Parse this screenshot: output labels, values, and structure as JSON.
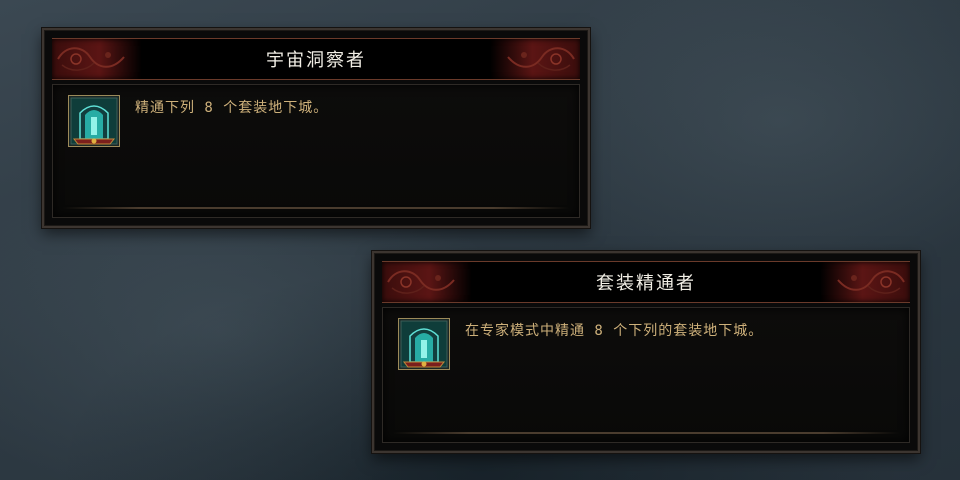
{
  "achievements": [
    {
      "title": "宇宙洞察者",
      "description": "精通下列 8 个套装地下城。",
      "icon": "portal-gate-icon"
    },
    {
      "title": "套装精通者",
      "description": "在专家模式中精通 8 个下列的套装地下城。",
      "icon": "portal-gate-icon"
    }
  ],
  "colors": {
    "title_text": "#f2efe6",
    "description_text": "#cdb07a",
    "title_bar_red": "#5b1514",
    "icon_cyan": "#2fd2c8"
  }
}
